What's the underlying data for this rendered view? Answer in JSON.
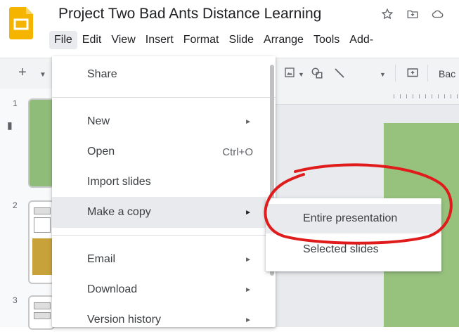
{
  "document": {
    "title": "Project Two Bad Ants Distance Learning"
  },
  "header_icons": [
    "star-icon",
    "move-to-folder-icon",
    "cloud-status-icon"
  ],
  "menubar": {
    "items": [
      "File",
      "Edit",
      "View",
      "Insert",
      "Format",
      "Slide",
      "Arrange",
      "Tools",
      "Add-"
    ],
    "active": "File"
  },
  "toolbar": {
    "new_slide_label": "+",
    "background_label": "Bac"
  },
  "filmstrip": {
    "slide_numbers": [
      "1",
      "2",
      "3"
    ]
  },
  "file_menu": {
    "items": [
      {
        "label": "Share",
        "shortcut": "",
        "submenu": false
      },
      {
        "label": "New",
        "shortcut": "",
        "submenu": true
      },
      {
        "label": "Open",
        "shortcut": "Ctrl+O",
        "submenu": false
      },
      {
        "label": "Import slides",
        "shortcut": "",
        "submenu": false
      },
      {
        "label": "Make a copy",
        "shortcut": "",
        "submenu": true
      },
      {
        "label": "Email",
        "shortcut": "",
        "submenu": true
      },
      {
        "label": "Download",
        "shortcut": "",
        "submenu": true
      },
      {
        "label": "Version history",
        "shortcut": "",
        "submenu": true
      }
    ],
    "hovered": "Make a copy",
    "arrow_glyph": "►"
  },
  "make_a_copy_submenu": {
    "items": [
      "Entire presentation",
      "Selected slides"
    ],
    "hovered": "Entire presentation"
  },
  "colors": {
    "annotation_red": "#e01b1b",
    "slide_green": "#97c27e",
    "logo_yellow": "#f4b400"
  }
}
